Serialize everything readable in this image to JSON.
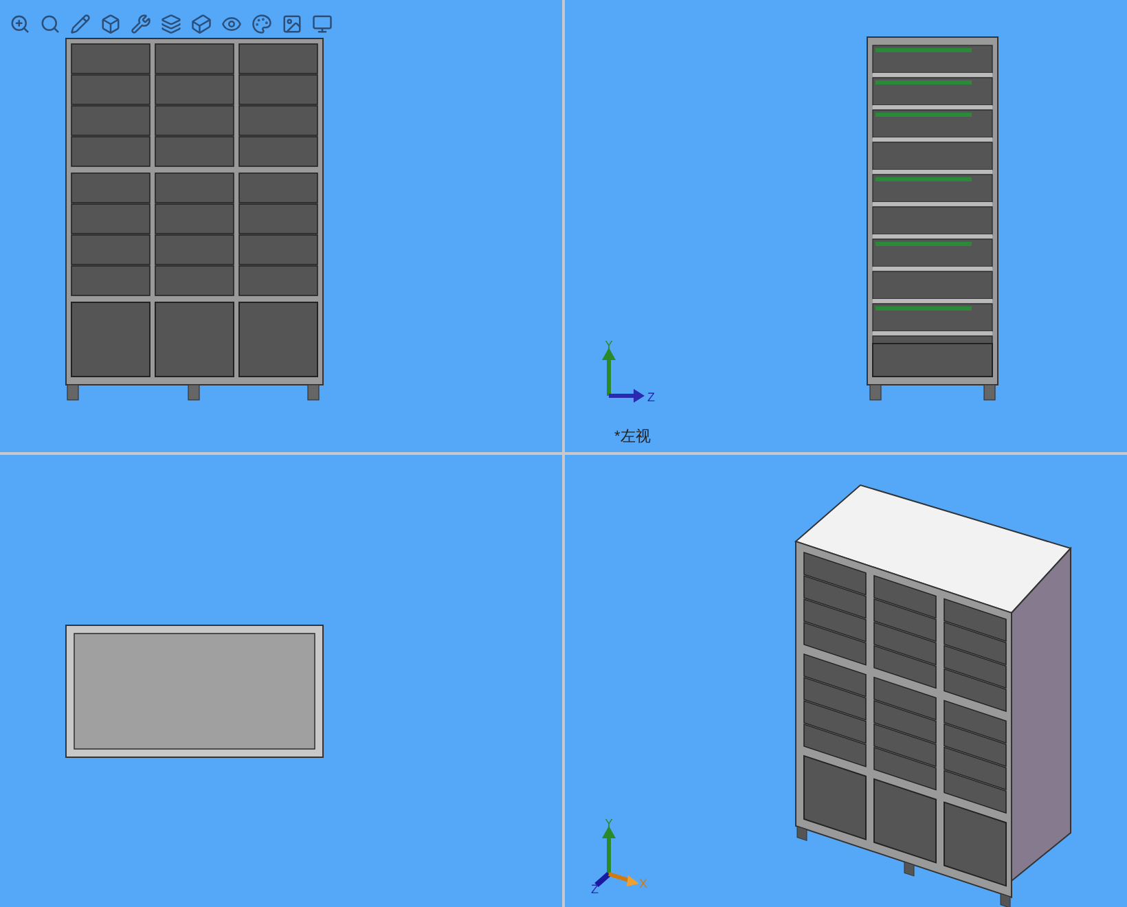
{
  "viewports": [
    {
      "kind": "front"
    },
    {
      "kind": "side",
      "axes": [
        "Y",
        "Z"
      ],
      "view_name": "*左视"
    },
    {
      "kind": "top"
    },
    {
      "kind": "iso",
      "axes": [
        "Y",
        "Z",
        "X"
      ]
    }
  ]
}
